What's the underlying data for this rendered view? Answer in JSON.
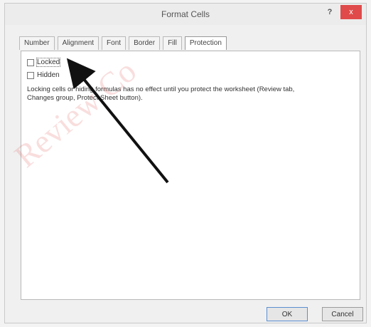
{
  "dialog": {
    "title": "Format Cells",
    "help_label": "?",
    "close_label": "x"
  },
  "tabs": [
    {
      "label": "Number"
    },
    {
      "label": "Alignment"
    },
    {
      "label": "Font"
    },
    {
      "label": "Border"
    },
    {
      "label": "Fill"
    },
    {
      "label": "Protection",
      "active": true
    }
  ],
  "protection": {
    "locked_label": "Locked",
    "locked_checked": false,
    "hidden_label": "Hidden",
    "hidden_checked": false,
    "note_line1": "Locking cells or hiding formulas has no effect until you protect the worksheet (Review tab,",
    "note_line2": "Changes group, Protect Sheet button)."
  },
  "buttons": {
    "ok_label": "OK",
    "cancel_label": "Cancel"
  },
  "watermark": {
    "text": "Review Co"
  },
  "colors": {
    "close_button": "#e04a4a",
    "arrow": "#111111",
    "watermark": "#e05050"
  }
}
